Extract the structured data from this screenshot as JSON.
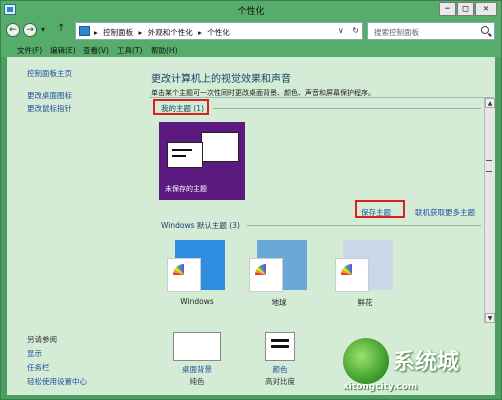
{
  "window": {
    "title": "个性化",
    "minimize": "−",
    "maximize": "□",
    "close": "✕"
  },
  "nav": {
    "back": "←",
    "forward": "→",
    "dropdown": "▾",
    "up": "↑",
    "breadcrumbs": [
      "控制面板",
      "外观和个性化",
      "个性化"
    ],
    "separator": "▸",
    "address_dropdown": "∨",
    "refresh": "↻",
    "search_placeholder": "搜索控制面板"
  },
  "menu": [
    "文件(F)",
    "编辑(E)",
    "查看(V)",
    "工具(T)",
    "帮助(H)"
  ],
  "sidebar": {
    "links": [
      "控制面板主页",
      "更改桌面图标",
      "更改鼠标指针"
    ],
    "see_also": "另请参阅",
    "see_also_links": [
      "显示",
      "任务栏",
      "轻松使用设置中心"
    ]
  },
  "main": {
    "title": "更改计算机上的视觉效果和声音",
    "description": "单击某个主题可一次性同时更改桌面背景、颜色、声音和屏幕保护程序。",
    "my_themes_label": "我的主题 (1)",
    "unsaved_theme": "未保存的主题",
    "save_theme": "保存主题",
    "get_more": "联机获取更多主题",
    "windows_default_label": "Windows 默认主题 (3)",
    "themes": [
      {
        "name": "Windows",
        "color": "#2f8ee0"
      },
      {
        "name": "地球",
        "color": "#6aa8d8"
      },
      {
        "name": "鲜花",
        "color": "#c9d7e8"
      }
    ]
  },
  "bottom": {
    "background": {
      "label": "桌面背景",
      "sub": "纯色"
    },
    "color": {
      "label": "颜色",
      "sub": "高对比度"
    }
  },
  "watermark": {
    "text": "系统城",
    "url": "xitongcity.com"
  }
}
